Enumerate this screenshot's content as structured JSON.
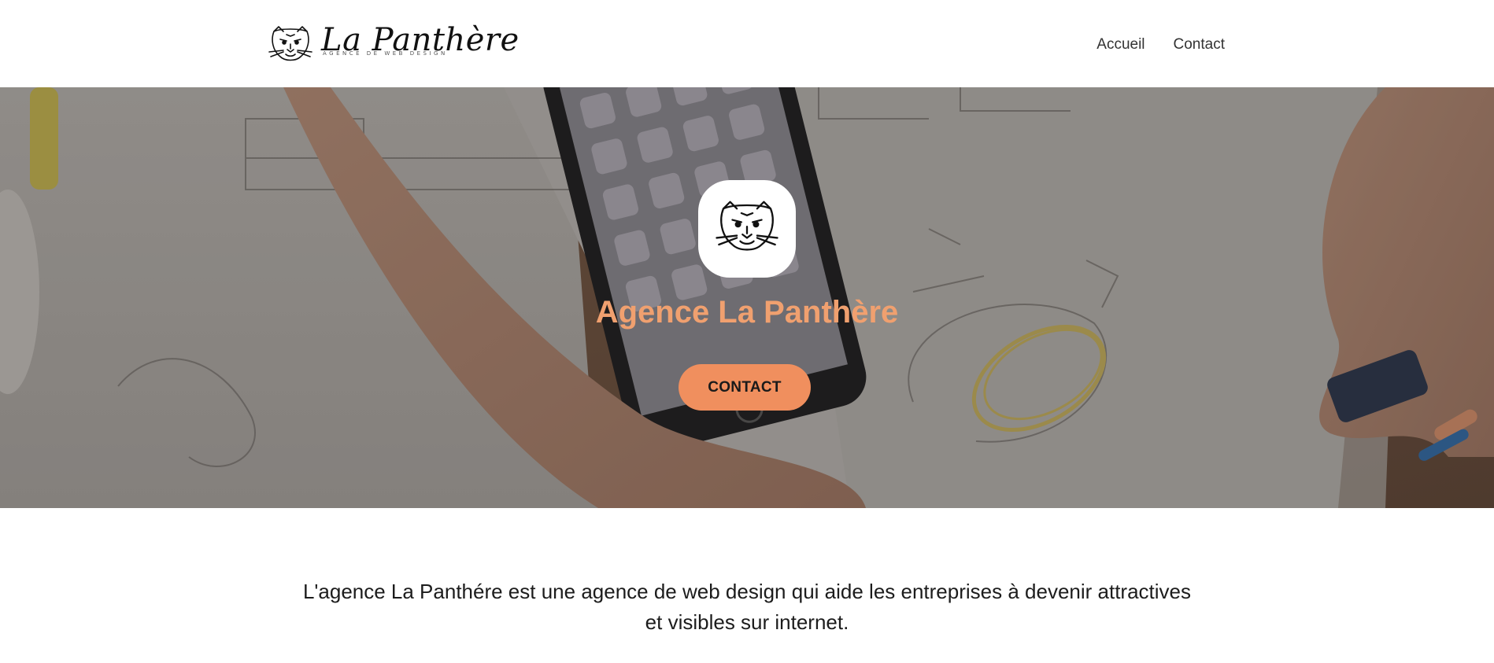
{
  "header": {
    "logo": {
      "title": "La Panthère",
      "tagline": "AGENCE DE WEB DESIGN",
      "icon": "panther-head-icon"
    },
    "nav": [
      {
        "label": "Accueil"
      },
      {
        "label": "Contact"
      }
    ]
  },
  "hero": {
    "badge_icon": "panther-head-icon",
    "title": "Agence La Panthère",
    "cta_label": "CONTACT",
    "accent_color": "#f08f5e",
    "title_color": "#f0a06f"
  },
  "intro": {
    "line1": "L'agence La Panthére est une agence de web design qui aide les entreprises à devenir attractives",
    "line2": "et visibles sur internet."
  }
}
